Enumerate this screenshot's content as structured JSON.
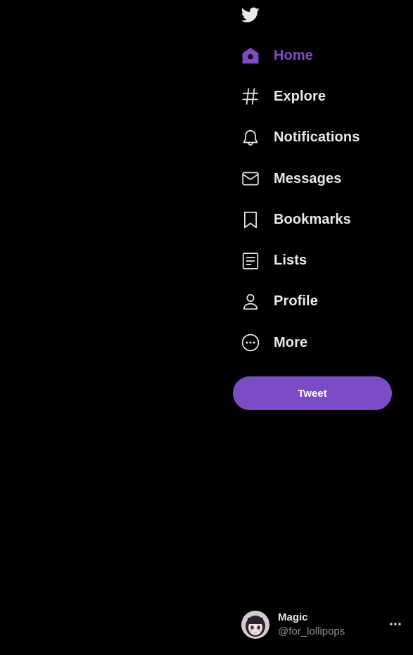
{
  "theme": {
    "background": "#000000",
    "accent": "#7b4cc6",
    "text": "#e7e9ea",
    "muted": "#8b8f94"
  },
  "logo": {
    "icon": "twitter-bird-icon"
  },
  "nav": {
    "items": [
      {
        "label": "Home",
        "icon": "home-icon",
        "active": true
      },
      {
        "label": "Explore",
        "icon": "hashtag-icon",
        "active": false
      },
      {
        "label": "Notifications",
        "icon": "bell-icon",
        "active": false
      },
      {
        "label": "Messages",
        "icon": "envelope-icon",
        "active": false
      },
      {
        "label": "Bookmarks",
        "icon": "bookmark-icon",
        "active": false
      },
      {
        "label": "Lists",
        "icon": "list-icon",
        "active": false
      },
      {
        "label": "Profile",
        "icon": "person-icon",
        "active": false
      },
      {
        "label": "More",
        "icon": "more-circle-icon",
        "active": false
      }
    ]
  },
  "tweet_button": {
    "label": "Tweet"
  },
  "account": {
    "name": "Magic",
    "handle": "@for_lollipops",
    "avatar_icon": "avatar-image",
    "more_icon": "ellipsis-icon"
  }
}
